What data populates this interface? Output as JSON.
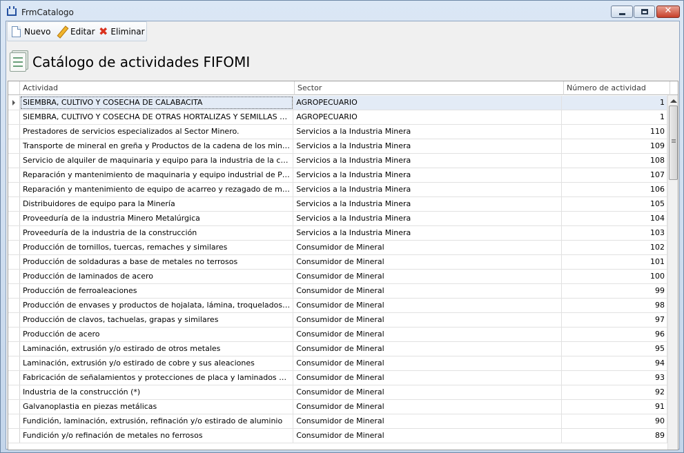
{
  "window": {
    "title": "FrmCatalogo"
  },
  "toolbar": {
    "nuevo": "Nuevo",
    "editar": "Editar",
    "eliminar": "Eliminar"
  },
  "header": {
    "title": "Catálogo de actividades FIFOMI"
  },
  "grid": {
    "columns": [
      "Actividad",
      "Sector",
      "Número de actividad"
    ],
    "rows": [
      {
        "actividad": "SIEMBRA, CULTIVO Y COSECHA DE CALABACITA",
        "sector": "AGROPECUARIO",
        "numero": "1"
      },
      {
        "actividad": "SIEMBRA, CULTIVO Y COSECHA DE OTRAS HORTALIZAS Y SEMILLAS DE HORTALIZAS",
        "sector": "AGROPECUARIO",
        "numero": "1"
      },
      {
        "actividad": "Prestadores de servicios especializados al Sector Minero.",
        "sector": "Servicios a la Industria Minera",
        "numero": "110"
      },
      {
        "actividad": "Transporte de mineral en greña y Productos de la cadena de los minerales.",
        "sector": "Servicios a la Industria Minera",
        "numero": "109"
      },
      {
        "actividad": "Servicio de alquiler de maquinaria y equipo para la industria de la cadena de los minerales",
        "sector": "Servicios a la Industria Minera",
        "numero": "108"
      },
      {
        "actividad": "Reparación y mantenimiento de maquinaria y equipo industrial de Plantas de Beneficio",
        "sector": "Servicios a la Industria Minera",
        "numero": "107"
      },
      {
        "actividad": "Reparación y mantenimiento de equipo de acarreo y rezagado de minería (exclusivamente)",
        "sector": "Servicios a la Industria Minera",
        "numero": "106"
      },
      {
        "actividad": "Distribuidores de equipo para la Minería",
        "sector": "Servicios a la Industria Minera",
        "numero": "105"
      },
      {
        "actividad": "Proveeduría de la industria Minero Metalúrgica",
        "sector": "Servicios a la Industria Minera",
        "numero": "104"
      },
      {
        "actividad": "Proveeduría de la industria de la construcción",
        "sector": "Servicios a la Industria Minera",
        "numero": "103"
      },
      {
        "actividad": "Producción de tornillos, tuercas, remaches y similares",
        "sector": "Consumidor de Mineral",
        "numero": "102"
      },
      {
        "actividad": "Producción de soldaduras a base de metales no terrosos",
        "sector": "Consumidor de Mineral",
        "numero": "101"
      },
      {
        "actividad": "Producción de laminados de acero",
        "sector": "Consumidor de Mineral",
        "numero": "100"
      },
      {
        "actividad": "Producción de ferroaleaciones",
        "sector": "Consumidor de Mineral",
        "numero": "99"
      },
      {
        "actividad": "Producción de envases y productos de hojalata, lámina, troquelados y esmaltados",
        "sector": "Consumidor de Mineral",
        "numero": "98"
      },
      {
        "actividad": "Producción de clavos, tachuelas, grapas y similares",
        "sector": "Consumidor de Mineral",
        "numero": "97"
      },
      {
        "actividad": "Producción de acero",
        "sector": "Consumidor de Mineral",
        "numero": "96"
      },
      {
        "actividad": "Laminación, extrusión y/o estirado de otros metales",
        "sector": "Consumidor de Mineral",
        "numero": "95"
      },
      {
        "actividad": "Laminación, extrusión y/o estirado de cobre y sus aleaciones",
        "sector": "Consumidor de Mineral",
        "numero": "94"
      },
      {
        "actividad": "Fabricación de señalamientos y protecciones de placa y laminados metálicos",
        "sector": "Consumidor de Mineral",
        "numero": "93"
      },
      {
        "actividad": "Industria de la construcción (*)",
        "sector": "Consumidor de Mineral",
        "numero": "92"
      },
      {
        "actividad": "Galvanoplastia en piezas metálicas",
        "sector": "Consumidor de Mineral",
        "numero": "91"
      },
      {
        "actividad": "Fundición, laminación, extrusión, refinación y/o estirado de aluminio",
        "sector": "Consumidor de Mineral",
        "numero": "90"
      },
      {
        "actividad": "Fundición y/o refinación de metales no ferrosos",
        "sector": "Consumidor de Mineral",
        "numero": "89"
      }
    ]
  }
}
